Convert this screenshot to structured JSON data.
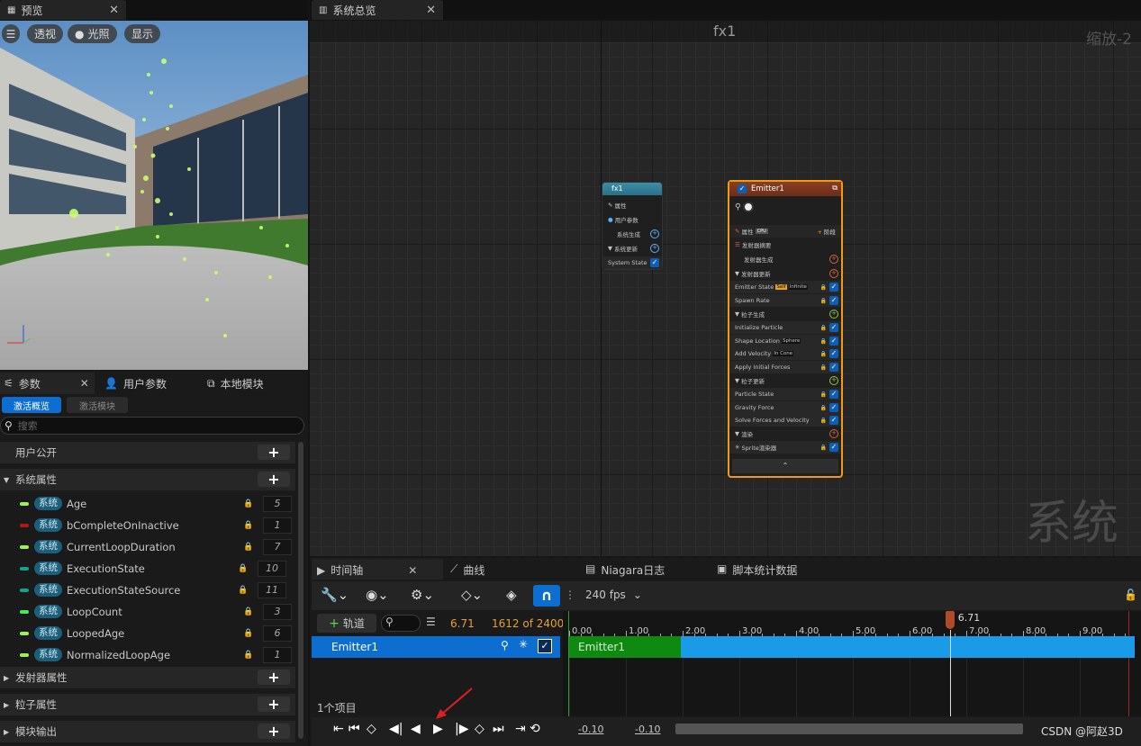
{
  "preview": {
    "tab": "预览",
    "btn_view": "透视",
    "btn_light": "光照",
    "btn_show": "显示"
  },
  "system_tab": "系统总览",
  "params_panel": {
    "tabs": [
      "参数",
      "用户参数",
      "本地模块"
    ],
    "toggle_active": "激活概览",
    "toggle_modules": "激活模块",
    "search_placeholder": "搜索",
    "user_public": "用户公开",
    "system_props": "系统属性",
    "badge": "系统",
    "items": [
      {
        "name": "Age",
        "value": "5",
        "color": "#9ef05a"
      },
      {
        "name": "bCompleteOnInactive",
        "value": "1",
        "color": "#b01818"
      },
      {
        "name": "CurrentLoopDuration",
        "value": "7",
        "color": "#9ef05a"
      },
      {
        "name": "ExecutionState",
        "value": "10",
        "color": "#15a08e"
      },
      {
        "name": "ExecutionStateSource",
        "value": "11",
        "color": "#15a08e"
      },
      {
        "name": "LoopCount",
        "value": "3",
        "color": "#4de85a"
      },
      {
        "name": "LoopedAge",
        "value": "6",
        "color": "#9ef05a"
      },
      {
        "name": "NormalizedLoopAge",
        "value": "1",
        "color": "#9ef05a"
      }
    ],
    "emitter_props": "发射器属性",
    "particle_props": "粒子属性",
    "module_output": "模块输出"
  },
  "graph": {
    "title": "fx1",
    "zoom": "缩放-2",
    "watermark": "系统",
    "sys_node": {
      "title": "fx1",
      "props": "属性",
      "user_params": "用户参数",
      "sys_spawn": "系统生成",
      "sys_update": "系统更新",
      "sys_state": "System State"
    },
    "emitter_node": {
      "title": "Emitter1",
      "props": "属性",
      "cpu": "CPU",
      "stage": "阶段",
      "summary": "发射器摘要",
      "spawn": "发射器生成",
      "update": "发射器更新",
      "emitter_state": "Emitter State",
      "self": "Self",
      "infinite": "Infinite",
      "spawn_rate": "Spawn Rate",
      "particle_spawn": "粒子生成",
      "init_particle": "Initialize Particle",
      "shape_location": "Shape Location",
      "sphere": "Sphere",
      "add_velocity": "Add Velocity",
      "in_cone": "In Cone",
      "apply_forces": "Apply Initial Forces",
      "particle_update": "粒子更新",
      "particle_state": "Particle State",
      "gravity": "Gravity Force",
      "solve": "Solve Forces and Velocity",
      "render": "渲染",
      "sprite": "Sprite渲染器"
    }
  },
  "timeline": {
    "tabs": [
      "时间轴",
      "曲线",
      "Niagara日志",
      "脚本统计数据"
    ],
    "fps": "240 fps",
    "add_track": "轨道",
    "time": "6.71",
    "frame": "1612 of 2400",
    "playhead": "6.71",
    "ticks": [
      "0.00",
      "1.00",
      "2.00",
      "3.00",
      "4.00",
      "5.00",
      "6.00",
      "7.00",
      "8.00",
      "9.00"
    ],
    "track": "Emitter1",
    "bar_label": "Emitter1",
    "items_count": "1个项目",
    "range_start": "-0.10",
    "range_end": "-0.10",
    "watermark": "CSDN @阿赵3D",
    "playhead_fraction": 0.671
  }
}
